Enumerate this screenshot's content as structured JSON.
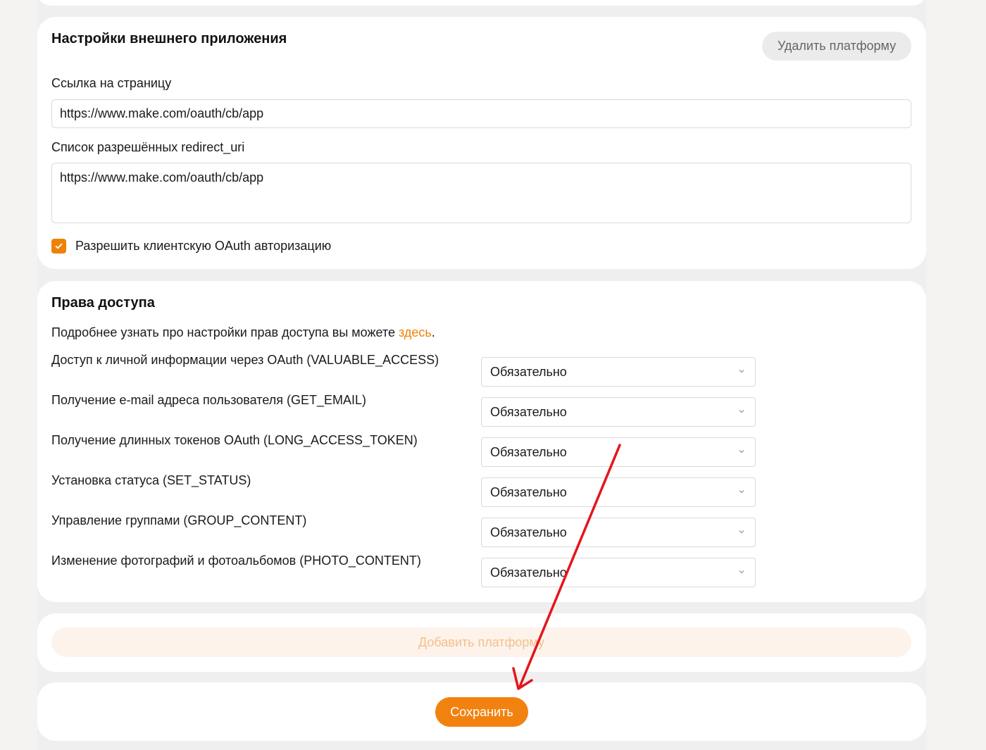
{
  "app_settings": {
    "title": "Настройки внешнего приложения",
    "delete_button": "Удалить платформу",
    "page_link_label": "Ссылка на страницу",
    "page_link_value": "https://www.make.com/oauth/cb/app",
    "redirect_label": "Список разрешённых redirect_uri",
    "redirect_value": "https://www.make.com/oauth/cb/app",
    "client_oauth_label": "Разрешить клиентскую OAuth авторизацию",
    "client_oauth_checked": true
  },
  "permissions": {
    "title": "Права доступа",
    "intro_text": "Подробнее узнать про настройки прав доступа вы можете ",
    "intro_link": "здесь",
    "intro_end": ".",
    "rows": [
      {
        "label": "Доступ к личной информации через OAuth (VALUABLE_ACCESS)",
        "value": "Обязательно"
      },
      {
        "label": "Получение e-mail адреса пользователя (GET_EMAIL)",
        "value": "Обязательно"
      },
      {
        "label": "Получение длинных токенов OAuth (LONG_ACCESS_TOKEN)",
        "value": "Обязательно"
      },
      {
        "label": "Установка статуса (SET_STATUS)",
        "value": "Обязательно"
      },
      {
        "label": "Управление группами (GROUP_CONTENT)",
        "value": "Обязательно"
      },
      {
        "label": "Изменение фотографий и фотоальбомов (PHOTO_CONTENT)",
        "value": "Обязательно"
      }
    ]
  },
  "add_platform_button": "Добавить платформу",
  "save_button": "Сохранить",
  "colors": {
    "accent": "#f28210",
    "annotation_arrow": "#e5151c"
  },
  "icons": {
    "checkbox": "check-icon",
    "select": "chevron-down-icon"
  }
}
